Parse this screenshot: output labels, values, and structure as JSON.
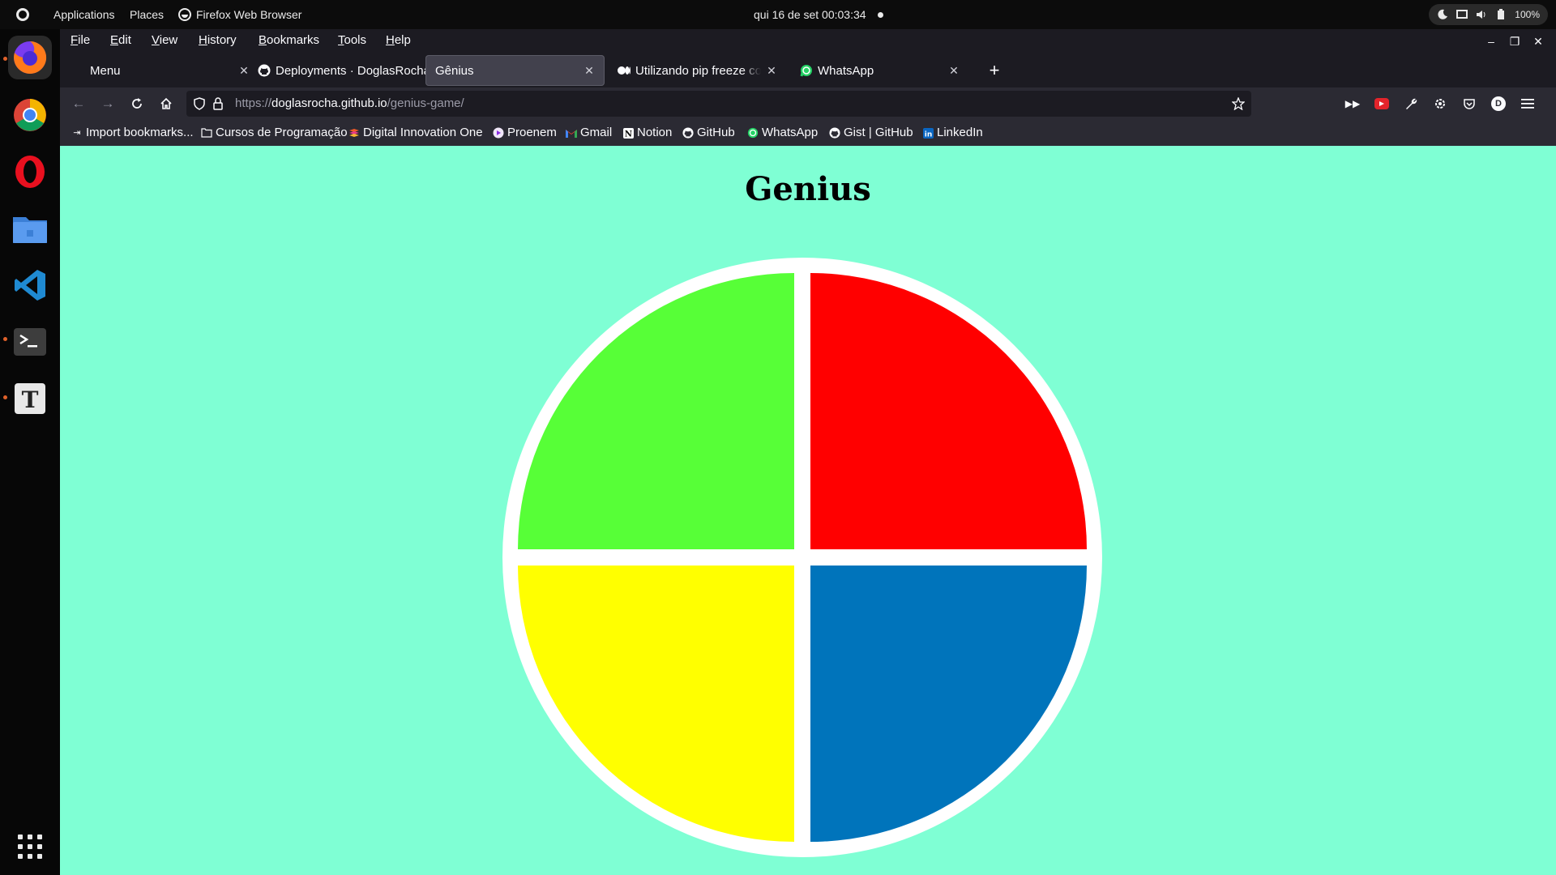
{
  "topbar": {
    "activities": "Activities",
    "applications": "Applications",
    "places": "Places",
    "app_name": "Firefox Web Browser",
    "clock": "qui 16 de set  00:03:34",
    "battery": "100%"
  },
  "dock": {
    "apps": [
      "Firefox",
      "Google Chrome",
      "Opera",
      "Files",
      "Visual Studio Code",
      "Terminal",
      "Text Editor"
    ],
    "show_apps": "Show Applications"
  },
  "menubar": {
    "items": [
      "File",
      "Edit",
      "View",
      "History",
      "Bookmarks",
      "Tools",
      "Help"
    ]
  },
  "tabs": [
    {
      "label": "Menu",
      "icon": "none"
    },
    {
      "label": "Deployments · DoglasRocha",
      "icon": "github-icon"
    },
    {
      "label": "Gênius",
      "icon": "none",
      "selected": true
    },
    {
      "label": "Utilizando pip freeze corretamente",
      "icon": "medium-icon"
    },
    {
      "label": "WhatsApp",
      "icon": "whatsapp-icon"
    }
  ],
  "urlbar": {
    "prefix": "https://",
    "host": "doglasrocha.github.io",
    "path": "/genius-game/"
  },
  "bookmarks": [
    {
      "label": "Import bookmarks...",
      "icon": "import-icon"
    },
    {
      "label": "Cursos de Programação",
      "icon": "folder-icon"
    },
    {
      "label": "Digital Innovation One",
      "icon": "dio-icon"
    },
    {
      "label": "Proenem",
      "icon": "proenem-icon"
    },
    {
      "label": "Gmail",
      "icon": "gmail-icon"
    },
    {
      "label": "Notion",
      "icon": "notion-icon"
    },
    {
      "label": "GitHub",
      "icon": "github-icon"
    },
    {
      "label": "WhatsApp",
      "icon": "whatsapp-icon"
    },
    {
      "label": "Gist | GitHub",
      "icon": "github-icon"
    },
    {
      "label": "LinkedIn",
      "icon": "linkedin-icon"
    }
  ],
  "page": {
    "title": "Genius",
    "colors": {
      "background": "#7fffd4",
      "green": "#57ff37",
      "red": "#ff0000",
      "yellow": "#ffff00",
      "blue": "#0074bb"
    }
  }
}
